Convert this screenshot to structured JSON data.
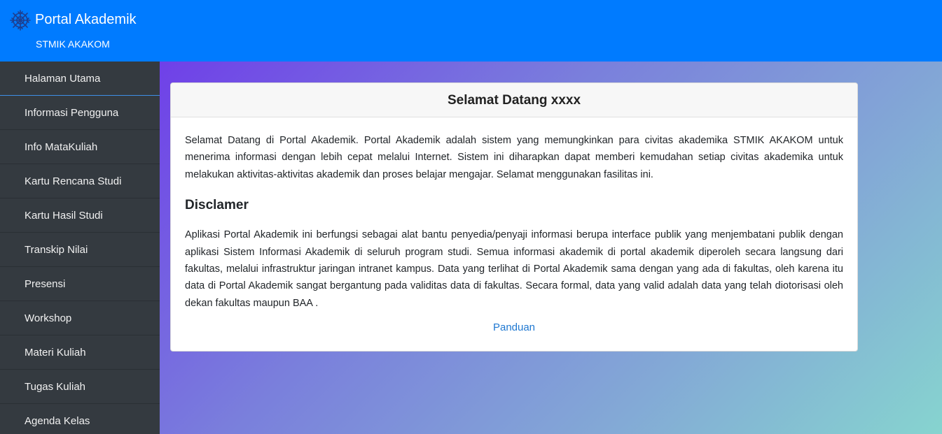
{
  "header": {
    "title": "Portal Akademik",
    "subtitle": "STMIK AKAKOM",
    "logo_icon": "snowflake-icon",
    "color": "#007bff"
  },
  "sidebar": {
    "items": [
      {
        "label": "Halaman Utama",
        "active": true
      },
      {
        "label": "Informasi Pengguna"
      },
      {
        "label": "Info MataKuliah"
      },
      {
        "label": "Kartu Rencana Studi"
      },
      {
        "label": "Kartu Hasil Studi"
      },
      {
        "label": "Transkip Nilai"
      },
      {
        "label": "Presensi"
      },
      {
        "label": "Workshop"
      },
      {
        "label": "Materi Kuliah"
      },
      {
        "label": "Tugas Kuliah"
      },
      {
        "label": "Agenda Kelas"
      }
    ]
  },
  "main": {
    "card_title": "Selamat Datang xxxx",
    "intro": "Selamat Datang di Portal Akademik. Portal Akademik adalah sistem yang memungkinkan para civitas akademika STMIK AKAKOM untuk menerima informasi dengan lebih cepat melalui Internet. Sistem ini diharapkan dapat memberi kemudahan setiap civitas akademika untuk melakukan aktivitas-aktivitas akademik dan proses belajar mengajar. Selamat menggunakan fasilitas ini.",
    "disclaimer_title": "Disclamer",
    "disclaimer": "Aplikasi Portal Akademik ini berfungsi sebagai alat bantu penyedia/penyaji informasi berupa interface publik yang menjembatani publik dengan aplikasi Sistem Informasi Akademik di seluruh program studi. Semua informasi akademik di portal akademik diperoleh secara langsung dari fakultas, melalui infrastruktur jaringan intranet kampus. Data yang terlihat di Portal Akademik sama dengan yang ada di fakultas, oleh karena itu data di Portal Akademik sangat bergantung pada validitas data di fakultas. Secara formal, data yang valid adalah data yang telah diotorisasi oleh dekan fakultas maupun BAA .",
    "guide_link": "Panduan"
  }
}
